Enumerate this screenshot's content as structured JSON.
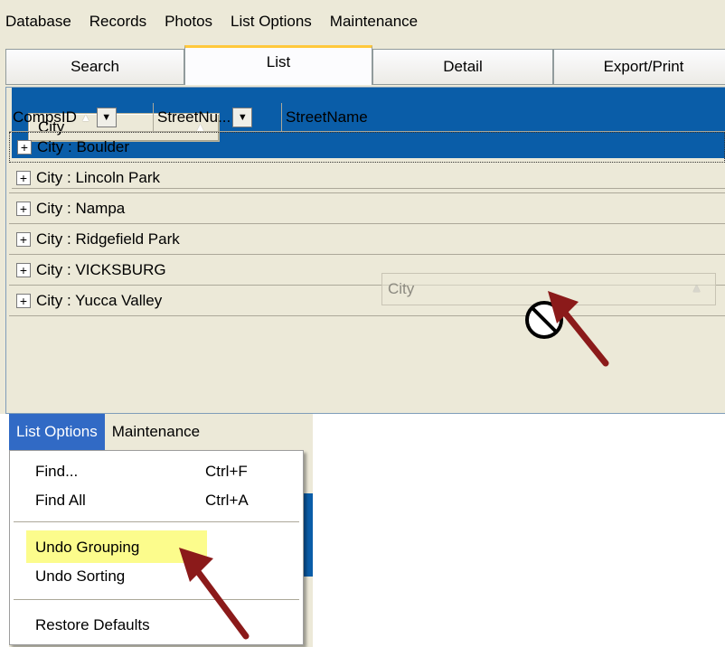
{
  "menubar": {
    "items": [
      "Database",
      "Records",
      "Photos",
      "List Options",
      "Maintenance"
    ]
  },
  "tabs": [
    {
      "label": "Search",
      "active": false
    },
    {
      "label": "List",
      "active": true
    },
    {
      "label": "Detail",
      "active": false
    },
    {
      "label": "Export/Print",
      "active": false
    }
  ],
  "group_panel": {
    "chip_label": "City"
  },
  "columns": [
    {
      "label": "CompsID"
    },
    {
      "label": "StreetNu..."
    },
    {
      "label": "StreetName"
    }
  ],
  "group_rows": [
    "City : Boulder",
    "City : Lincoln Park",
    "City : Nampa",
    "City : Ridgefield Park",
    "City : VICKSBURG",
    "City : Yucca Valley"
  ],
  "drag_ghost_label": "City",
  "popup": {
    "menubar": [
      "List Options",
      "Maintenance"
    ],
    "items": {
      "find": {
        "label": "Find...",
        "shortcut": "Ctrl+F"
      },
      "find_all": {
        "label": "Find All",
        "shortcut": "Ctrl+A"
      },
      "undo_grouping": {
        "label": "Undo Grouping"
      },
      "undo_sorting": {
        "label": "Undo Sorting"
      },
      "restore_defaults": {
        "label": "Restore Defaults"
      }
    }
  },
  "colors": {
    "window_bg": "#ece9d8",
    "group_area_blue": "#0a5da8",
    "menu_highlight": "#316ac5",
    "tab_accent": "#ffc83c",
    "annotation_arrow": "#8b1a1a",
    "callout_highlight": "#fcfc8c"
  }
}
